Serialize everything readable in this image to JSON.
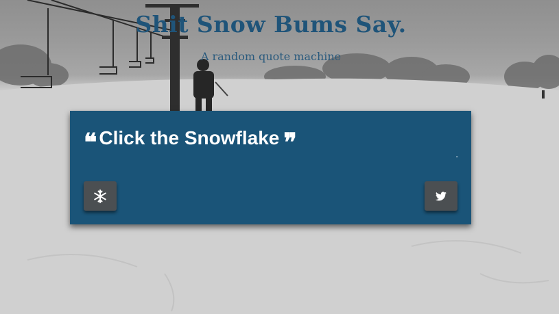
{
  "header": {
    "title": "Shit Snow Bums Say.",
    "subtitle": "A random quote machine"
  },
  "quote_card": {
    "open_mark": "❝",
    "text": "Click the Snowflake",
    "close_mark": "❞",
    "author": "-",
    "new_quote_button": "snowflake-icon",
    "tweet_button": "twitter-icon"
  },
  "colors": {
    "title": "#1f5479",
    "card_background": "#1a5478",
    "button_background": "#4b4f52",
    "text": "#ffffff"
  }
}
